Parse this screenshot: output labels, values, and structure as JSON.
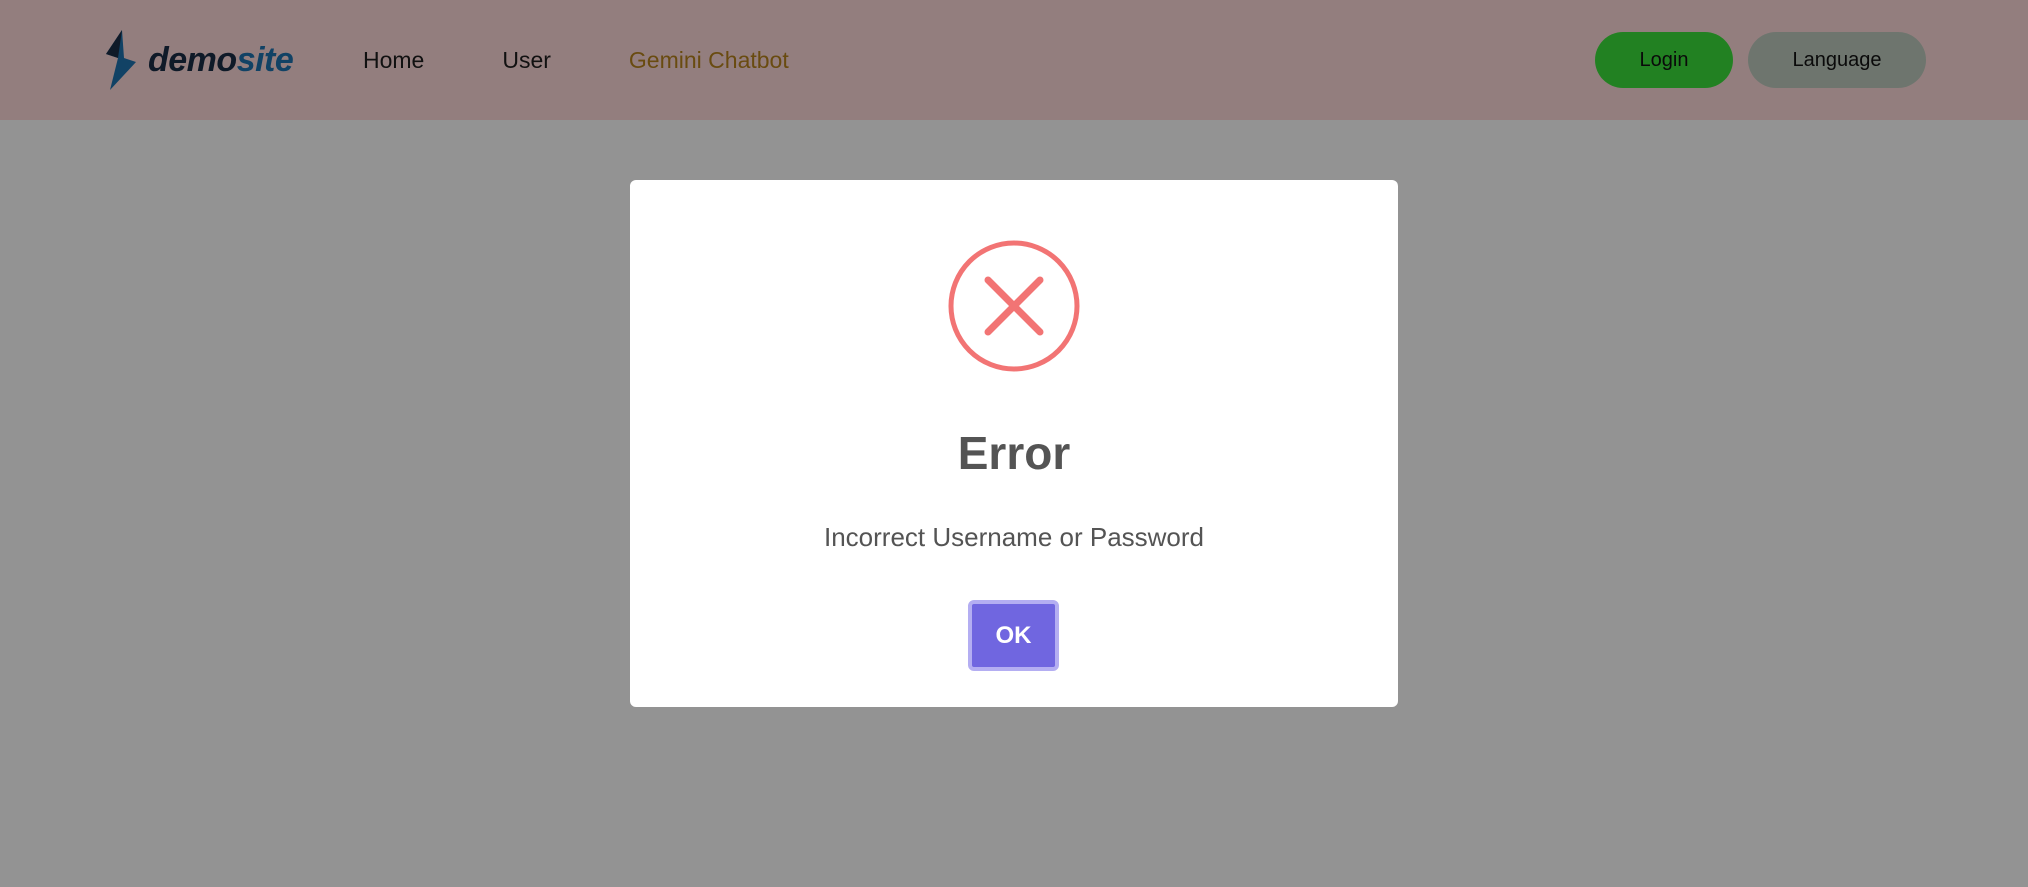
{
  "brand": {
    "part1": "demo",
    "part2": "site",
    "icon": "lightning-bolt-icon"
  },
  "nav": {
    "links": [
      {
        "label": "Home"
      },
      {
        "label": "User"
      },
      {
        "label": "Gemini Chatbot"
      }
    ],
    "login_label": "Login",
    "language_label": "Language"
  },
  "modal": {
    "icon": "error-x-icon",
    "title": "Error",
    "message": "Incorrect Username or Password",
    "ok_label": "OK"
  },
  "colors": {
    "navbar_bg": "#f6d3d3",
    "active_link": "#b07e1c",
    "login_button": "#3ad83a",
    "language_button": "#b8c4b8",
    "error_icon": "#f27474",
    "ok_button": "#7066e0",
    "backdrop": "rgba(0,0,0,0.4)"
  }
}
